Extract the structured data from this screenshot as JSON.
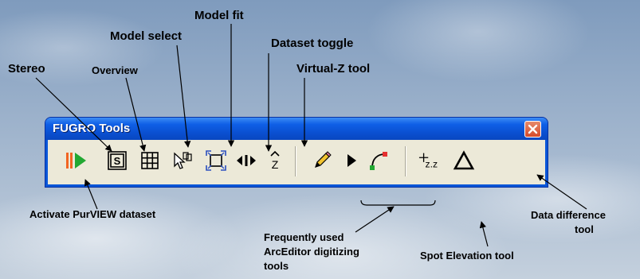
{
  "window": {
    "title": "FUGRO Tools"
  },
  "annotations": {
    "model_fit": "Model fit",
    "model_select": "Model select",
    "dataset_toggle": "Dataset toggle",
    "stereo": "Stereo",
    "overview": "Overview",
    "virtual_z": "Virtual-Z tool",
    "activate": "Activate PurVIEW dataset",
    "data_difference_1": "Data difference",
    "data_difference_2": "tool",
    "frequent_1": "Frequently used",
    "frequent_2": "ArcEditor digitizing",
    "frequent_3": "tools",
    "spot_elevation": "Spot Elevation tool"
  },
  "tools": {
    "stereo_letter": "S",
    "virtual_z_letter": "Z",
    "spot_elevation_label": "z.z"
  },
  "colors": {
    "title_bar": "#0a4fd0",
    "toolbar_bg": "#ece9d8",
    "activate_green": "#22a832",
    "activate_orange": "#f26522"
  }
}
